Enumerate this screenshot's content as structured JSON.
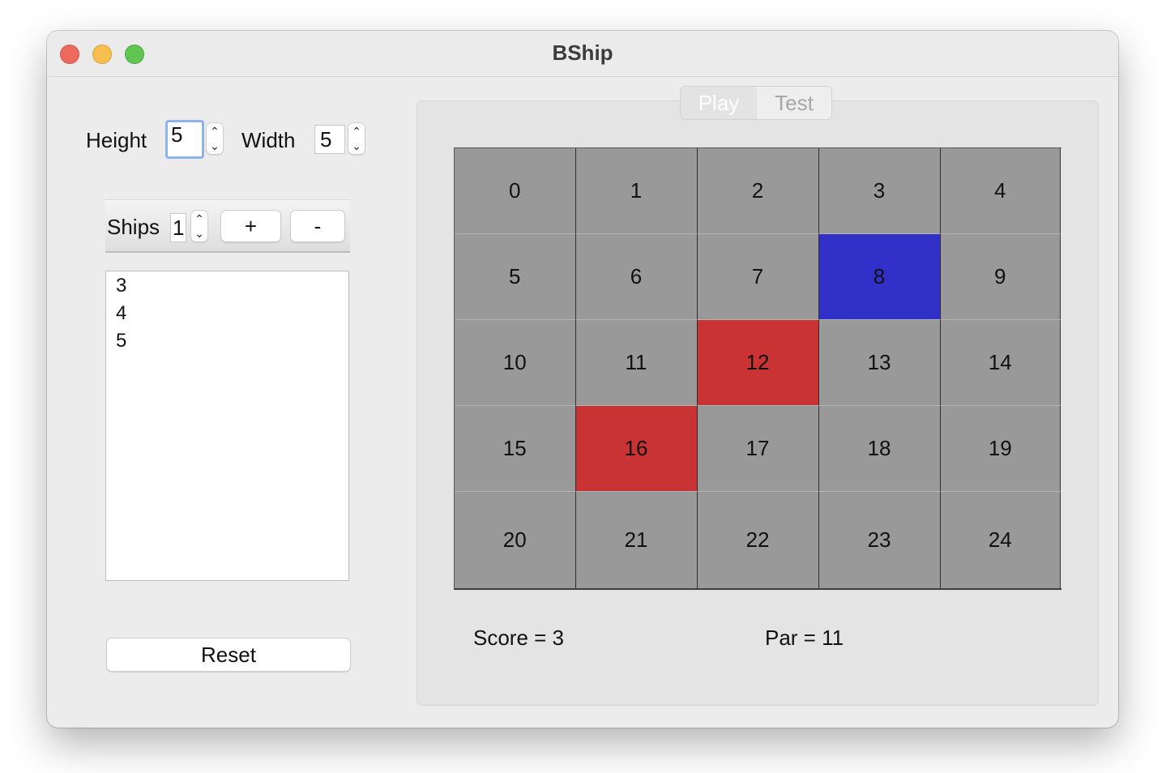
{
  "window": {
    "title": "BShip"
  },
  "controls": {
    "height_label": "Height",
    "height_value": "5",
    "width_label": "Width",
    "width_value": "5",
    "ships_label": "Ships",
    "ships_value": "1",
    "add_label": "+",
    "remove_label": "-",
    "reset_label": "Reset"
  },
  "ship_list": [
    "3",
    "4",
    "5"
  ],
  "tabs": [
    {
      "label": "Play",
      "selected": true
    },
    {
      "label": "Test",
      "selected": false
    }
  ],
  "board": {
    "rows": 5,
    "cols": 5,
    "cells": [
      "0",
      "1",
      "2",
      "3",
      "4",
      "5",
      "6",
      "7",
      "8",
      "9",
      "10",
      "11",
      "12",
      "13",
      "14",
      "15",
      "16",
      "17",
      "18",
      "19",
      "20",
      "21",
      "22",
      "23",
      "24"
    ],
    "highlighted": {
      "8": "blue",
      "12": "red",
      "16": "red"
    },
    "colors": {
      "default": "#999999",
      "blue": "#3130c8",
      "red": "#c93333"
    }
  },
  "status": {
    "score": "Score = 3",
    "par": "Par = 11"
  }
}
